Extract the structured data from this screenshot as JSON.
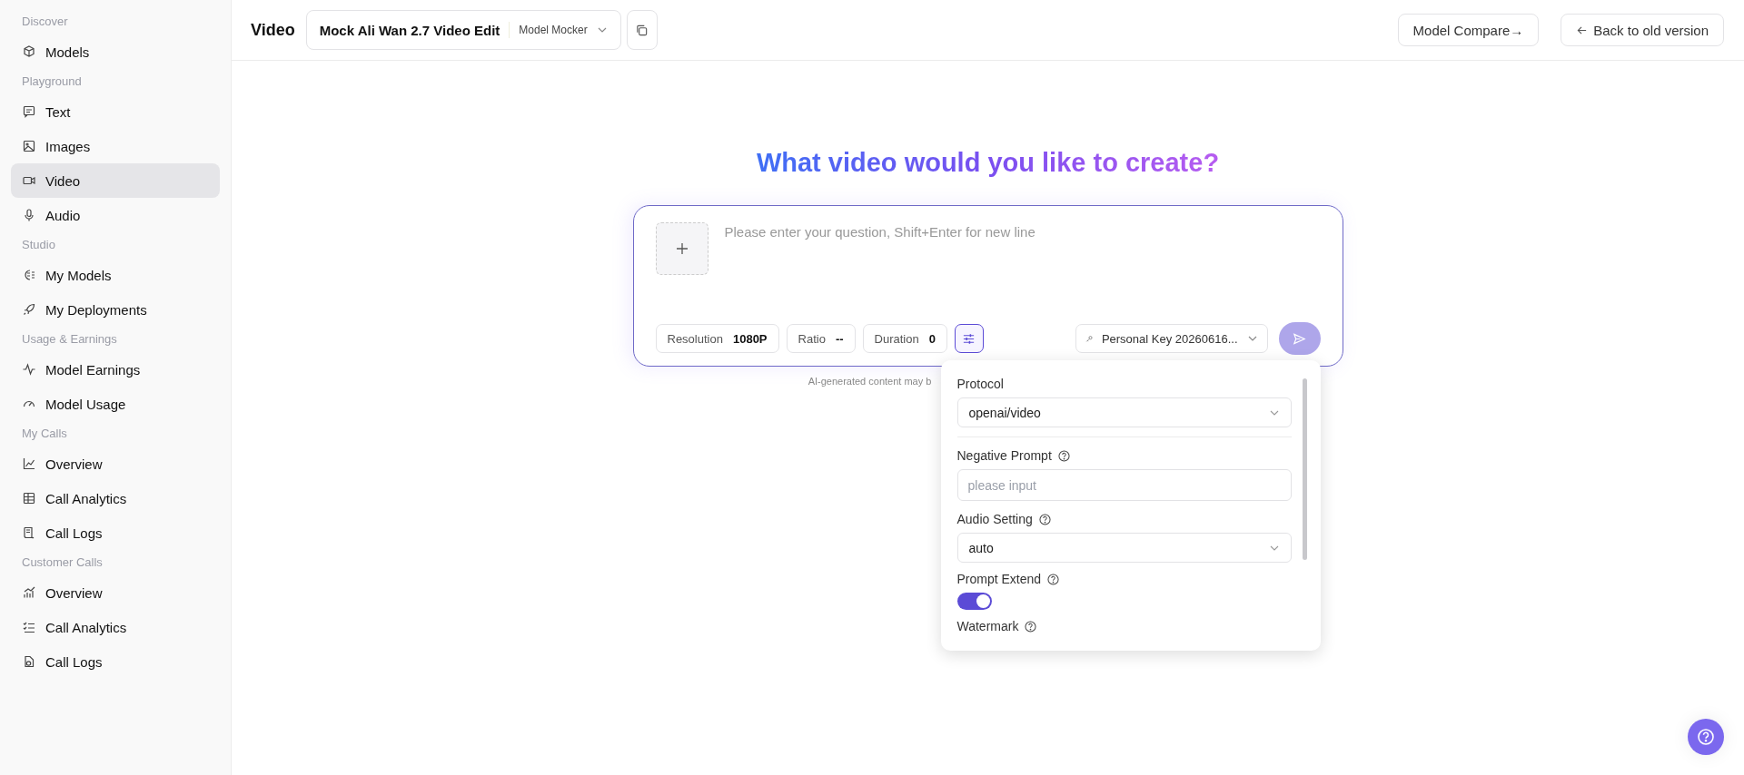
{
  "sidebar": {
    "sections": [
      {
        "heading": "Discover",
        "items": [
          {
            "label": "Models",
            "selected": false
          }
        ]
      },
      {
        "heading": "Playground",
        "items": [
          {
            "label": "Text",
            "selected": false
          },
          {
            "label": "Images",
            "selected": false
          },
          {
            "label": "Video",
            "selected": true
          },
          {
            "label": "Audio",
            "selected": false
          }
        ]
      },
      {
        "heading": "Studio",
        "items": [
          {
            "label": "My Models",
            "selected": false
          },
          {
            "label": "My Deployments",
            "selected": false
          }
        ]
      },
      {
        "heading": "Usage & Earnings",
        "items": [
          {
            "label": "Model Earnings",
            "selected": false
          },
          {
            "label": "Model Usage",
            "selected": false
          }
        ]
      },
      {
        "heading": "My Calls",
        "items": [
          {
            "label": "Overview",
            "selected": false
          },
          {
            "label": "Call Analytics",
            "selected": false
          },
          {
            "label": "Call Logs",
            "selected": false
          }
        ]
      },
      {
        "heading": "Customer Calls",
        "items": [
          {
            "label": "Overview",
            "selected": false
          },
          {
            "label": "Call Analytics",
            "selected": false
          },
          {
            "label": "Call Logs",
            "selected": false
          }
        ]
      }
    ]
  },
  "header": {
    "title": "Video",
    "model": {
      "name": "Mock Ali Wan 2.7 Video Edit",
      "provider": "Model Mocker"
    },
    "compare_button": "Model Compare→",
    "back_button": "Back to old version"
  },
  "hero": {
    "title": "What video would you like to create?"
  },
  "composer": {
    "placeholder": "Please enter your question, Shift+Enter for new line",
    "chips": [
      {
        "label": "Resolution",
        "value": "1080P"
      },
      {
        "label": "Ratio",
        "value": "--"
      },
      {
        "label": "Duration",
        "value": "0"
      }
    ],
    "settings_active": true,
    "key": "Personal Key 20260616...",
    "send_disabled": true,
    "note": "AI-generated content may b"
  },
  "settings_panel": {
    "fields": [
      {
        "kind": "select",
        "label": "Protocol",
        "help": false,
        "value": "openai/video",
        "divider": true
      },
      {
        "kind": "input",
        "label": "Negative Prompt",
        "help": true,
        "placeholder": "please input",
        "divider": false
      },
      {
        "kind": "select",
        "label": "Audio Setting",
        "help": true,
        "value": "auto",
        "divider": false
      },
      {
        "kind": "toggle",
        "label": "Prompt Extend",
        "help": true,
        "on": true,
        "divider": false
      },
      {
        "kind": "label",
        "label": "Watermark",
        "help": true,
        "divider": false
      }
    ]
  }
}
